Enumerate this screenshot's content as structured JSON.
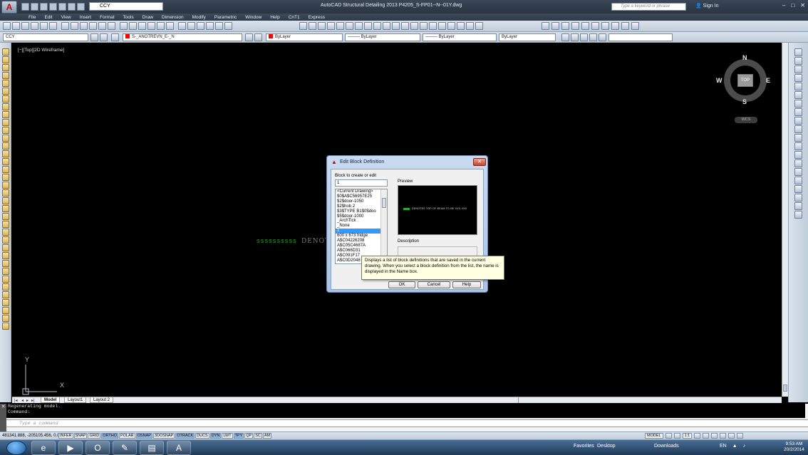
{
  "title_bar": {
    "app_icon": "autocad-logo-icon",
    "workspace": "CCY",
    "title": "AutoCAD Structural Detailing 2013   P4205_S-FP01--N--01Y.dwg",
    "search_placeholder": "Type a keyword or phrase",
    "sign_in": "Sign In",
    "window_controls": [
      "–",
      "□",
      "✕"
    ]
  },
  "menu": {
    "items": [
      "File",
      "Edit",
      "View",
      "Insert",
      "Format",
      "Tools",
      "Draw",
      "Dimension",
      "Modify",
      "Parametric",
      "Window",
      "Help",
      "CnT1",
      "Express"
    ]
  },
  "toolbar2": {
    "named_style": "CCY",
    "layer": "S-_ANOTREVN_E-_N",
    "color": "ByLayer",
    "linetype": "ByLayer",
    "lineweight": "ByLayer",
    "plotstyle": "ByLayer",
    "layer_color": "#ff0000"
  },
  "viewport": {
    "label": "[−][Top][2D Wireframe]"
  },
  "viewcube": {
    "north": "N",
    "south": "S",
    "east": "E",
    "west": "W",
    "top": "TOP",
    "wcs": "WCS"
  },
  "drawing": {
    "green_text": "SSSSSSSSSS",
    "white_text": "DENOT"
  },
  "ucs": {
    "x": "X",
    "y": "Y"
  },
  "dialog": {
    "title": "Edit Block Definition",
    "block_label": "Block to create or edit",
    "block_value": "1",
    "list_items": [
      "<Current Drawing>",
      "$0$A$C56957E25",
      "$2$door-1050",
      "$2$hob 2",
      "$3$TYPE B1$0$doo",
      "$5$door-1000",
      "_ArchTick",
      "_None",
      "1",
      "600 x 673 fridge",
      "A$C04226208",
      "A$C05C4687A",
      "A$C066D31",
      "A$C091F17",
      "A$C0D2048"
    ],
    "selected_index": 8,
    "preview_label": "Preview",
    "preview_text": "DENOTES TOP OF BEAM TO BE XXX.XXX",
    "description_label": "Description",
    "ok": "OK",
    "cancel": "Cancel",
    "help": "Help"
  },
  "tooltip": {
    "text": "Displays a list of block definitions that are saved in the current drawing. When you select a block definition from the list, the name is displayed in the Name box."
  },
  "layout_tabs": {
    "tabs": [
      "Model",
      "Layout1",
      "Layout 2"
    ],
    "active": "Model"
  },
  "command": {
    "history_1": "Regenerating model.",
    "history_2": "Command:",
    "placeholder": "Type a command"
  },
  "status": {
    "coords": "481341.888, -205105.456, 0.000",
    "toggles": [
      "INFER",
      "SNAP",
      "GRID",
      "ORTHO",
      "POLAR",
      "OSNAP",
      "3DOSNAP",
      "OTRACK",
      "DUCS",
      "DYN",
      "LWT",
      "TPY",
      "QP",
      "SC",
      "AM"
    ],
    "toggles_on": [
      "ORTHO",
      "OSNAP",
      "OTRACK",
      "DYN",
      "TPY"
    ],
    "model": "MODEL",
    "scale": "1:1"
  },
  "taskbar": {
    "favorites": "Favorites",
    "desktop": "Desktop",
    "downloads": "Downloads",
    "lang": "EN",
    "time": "9:53 AM",
    "date": "20/2/2014"
  }
}
